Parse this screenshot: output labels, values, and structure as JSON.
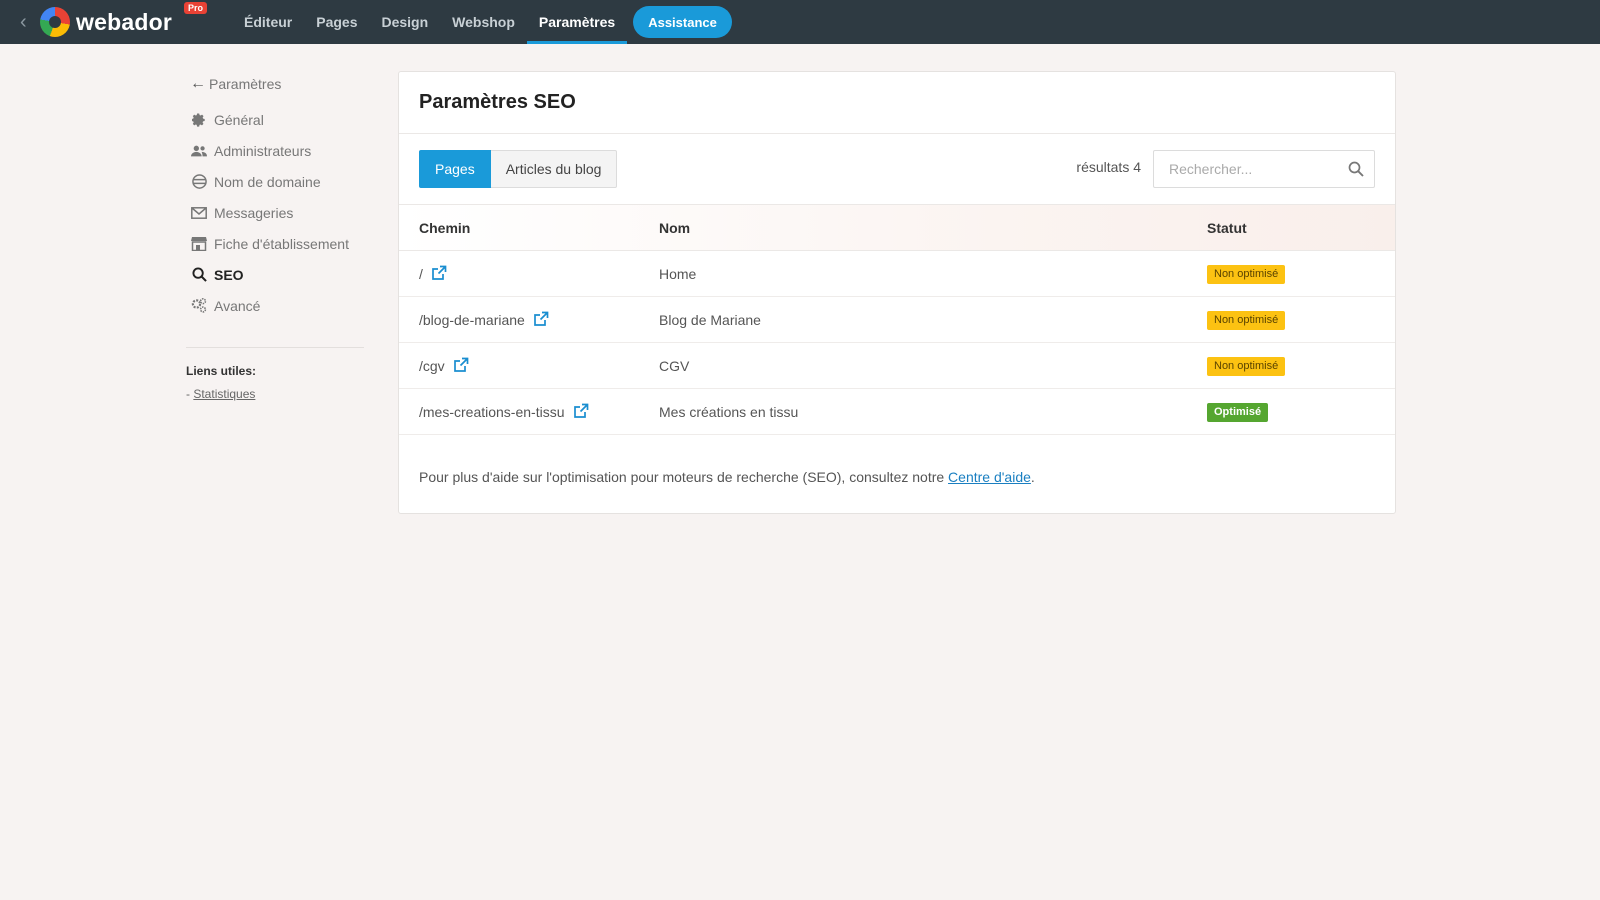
{
  "topbar": {
    "brand": "webador",
    "pro_badge": "Pro",
    "nav": [
      "Éditeur",
      "Pages",
      "Design",
      "Webshop",
      "Paramètres"
    ],
    "active_nav": "Paramètres",
    "assist_label": "Assistance",
    "colors": {
      "bar": "#2e3a42",
      "accent": "#1a9ad9"
    }
  },
  "sidebar": {
    "back_label": "Paramètres",
    "items": [
      {
        "label": "Général",
        "icon": "gear-icon"
      },
      {
        "label": "Administrateurs",
        "icon": "users-icon"
      },
      {
        "label": "Nom de domaine",
        "icon": "globe-icon"
      },
      {
        "label": "Messageries",
        "icon": "envelope-icon"
      },
      {
        "label": "Fiche d'établissement",
        "icon": "store-icon"
      },
      {
        "label": "SEO",
        "icon": "search-icon",
        "active": true
      },
      {
        "label": "Avancé",
        "icon": "gears-icon"
      }
    ],
    "links_title": "Liens utiles:",
    "links_prefix": "- ",
    "links": [
      "Statistiques"
    ]
  },
  "main": {
    "title": "Paramètres SEO",
    "tabs": [
      "Pages",
      "Articles du blog"
    ],
    "active_tab": "Pages",
    "results_label": "résultats 4",
    "search_placeholder": "Rechercher...",
    "columns": [
      "Chemin",
      "Nom",
      "Statut"
    ],
    "rows": [
      {
        "path": "/",
        "name": "Home",
        "status": "Non optimisé",
        "status_type": "warn"
      },
      {
        "path": "/blog-de-mariane",
        "name": "Blog de Mariane",
        "status": "Non optimisé",
        "status_type": "warn"
      },
      {
        "path": "/cgv",
        "name": "CGV",
        "status": "Non optimisé",
        "status_type": "warn"
      },
      {
        "path": "/mes-creations-en-tissu",
        "name": "Mes créations en tissu",
        "status": "Optimisé",
        "status_type": "ok"
      }
    ],
    "help_text": "Pour plus d'aide sur l'optimisation pour moteurs de recherche (SEO), consultez notre ",
    "help_link": "Centre d'aide",
    "help_suffix": "."
  }
}
